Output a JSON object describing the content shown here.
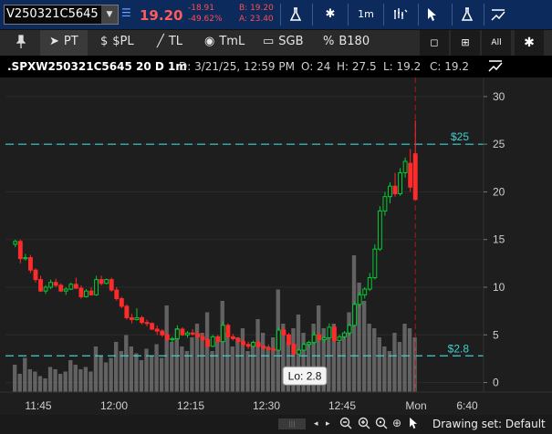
{
  "topbar": {
    "symbol": "V250321C5645",
    "last": "19.20",
    "change": "-18.91",
    "change_pct": "-49.62%",
    "bid": "B: 19.20",
    "ask": "A: 23.40",
    "timeframe_label": "1m",
    "icons": [
      "flask-icon",
      "gear-icon",
      "timeframe",
      "style-icon",
      "cursor-icon",
      "flask-icon",
      "chart-style-icon"
    ]
  },
  "toolbar": {
    "pin_icon": "pin-icon",
    "pt_label": "PT",
    "spl_label": "$PL",
    "tl_label": "TL",
    "tml_label": "TmL",
    "sgb_label": "SGB",
    "b180_label": "B180",
    "right_icons": [
      "square-icon",
      "grid-icon",
      "all-label",
      "gear-icon"
    ],
    "all_text": "All"
  },
  "header": {
    "title": ".SPXW250321C5645 20 D 1m",
    "date": "D: 3/21/25, 12:59 PM",
    "open": "O: 24",
    "high": "H: 27.5",
    "low": "L: 19.2",
    "close": "C: 19.2"
  },
  "chart_data": {
    "type": "candlestick",
    "y_ticks": [
      "30",
      "25",
      "20",
      "15",
      "10",
      "5",
      "0"
    ],
    "x_ticks": [
      "11:45",
      "12:00",
      "12:15",
      "12:30",
      "12:45",
      "Mon",
      "6:40"
    ],
    "ylim": [
      -1,
      32
    ],
    "level_lines": [
      {
        "label": "$25",
        "value": 25,
        "color": "#3fd0d0"
      },
      {
        "label": "$2.8",
        "value": 2.8,
        "color": "#3fd0d0"
      }
    ],
    "low_marker": "Lo: 2.8",
    "colors": {
      "up": "#00cc33",
      "down": "#ff2a2a",
      "volume": "#7a7a7a"
    },
    "candles": [
      [
        14.5,
        15,
        14.2,
        14.8
      ],
      [
        14.8,
        15,
        12.5,
        13
      ],
      [
        13,
        13.5,
        12.8,
        13.1
      ],
      [
        13.1,
        13.4,
        11.5,
        11.8
      ],
      [
        11.8,
        12,
        10.5,
        10.8
      ],
      [
        10.8,
        11.2,
        9.5,
        9.6
      ],
      [
        9.6,
        10.2,
        9.3,
        10
      ],
      [
        10,
        10.8,
        9.8,
        10.5
      ],
      [
        10.5,
        10.9,
        10,
        10.2
      ],
      [
        10.2,
        10.4,
        9.5,
        9.6
      ],
      [
        9.6,
        10,
        9.2,
        9.8
      ],
      [
        9.8,
        10.5,
        9.7,
        10.3
      ],
      [
        10.3,
        11,
        9.8,
        9.9
      ],
      [
        9.9,
        10.2,
        8.8,
        9
      ],
      [
        9,
        9.8,
        8.9,
        9.6
      ],
      [
        9.6,
        10,
        9.1,
        9.2
      ],
      [
        9.2,
        11.2,
        9.1,
        10.8
      ],
      [
        10.8,
        11.2,
        10.2,
        10.4
      ],
      [
        10.4,
        10.9,
        10.3,
        10.8
      ],
      [
        10.8,
        11,
        9.5,
        9.7
      ],
      [
        9.7,
        10,
        8.6,
        8.8
      ],
      [
        8.8,
        9,
        7.8,
        8
      ],
      [
        8,
        8.2,
        6.6,
        6.8
      ],
      [
        6.8,
        7.2,
        6.2,
        6.6
      ],
      [
        6.6,
        7.8,
        6.5,
        6.8
      ],
      [
        6.8,
        7,
        6.1,
        6.3
      ],
      [
        6.3,
        6.6,
        5.9,
        6.2
      ],
      [
        6.2,
        6.3,
        5.5,
        5.6
      ],
      [
        5.6,
        6,
        5,
        5.4
      ],
      [
        5.4,
        5.6,
        4.8,
        5
      ],
      [
        5,
        5.2,
        4.3,
        4.5
      ],
      [
        4.5,
        4.8,
        4.2,
        4.6
      ],
      [
        4.6,
        6,
        4.5,
        5.6
      ],
      [
        5.6,
        5.8,
        4.9,
        5
      ],
      [
        5,
        5.4,
        4.7,
        5.2
      ],
      [
        5.2,
        5.6,
        4.9,
        5.1
      ],
      [
        5.1,
        5.4,
        4.6,
        4.8
      ],
      [
        4.8,
        5.2,
        4.2,
        4.5
      ],
      [
        4.5,
        4.8,
        3.6,
        3.8
      ],
      [
        3.8,
        5,
        3.7,
        4.8
      ],
      [
        4.8,
        5,
        4.1,
        4.3
      ],
      [
        4.3,
        6.4,
        4.2,
        6
      ],
      [
        6,
        6.2,
        4.6,
        4.8
      ],
      [
        4.8,
        5.1,
        4.4,
        4.6
      ],
      [
        4.6,
        4.8,
        4.1,
        4.3
      ],
      [
        4.3,
        4.6,
        3.8,
        4
      ],
      [
        4,
        4.3,
        3.5,
        3.8
      ],
      [
        3.8,
        4.4,
        3.7,
        4.2
      ],
      [
        4.2,
        4.5,
        3.6,
        3.8
      ],
      [
        3.8,
        4,
        3.4,
        3.6
      ],
      [
        3.6,
        4,
        3.3,
        3.5
      ],
      [
        3.5,
        3.8,
        3.2,
        3.4
      ],
      [
        3.4,
        5.8,
        3.3,
        5.5
      ],
      [
        5.5,
        5.8,
        4.8,
        5
      ],
      [
        5,
        5.2,
        3.8,
        4
      ],
      [
        4,
        4.2,
        2.8,
        3
      ],
      [
        3,
        3.6,
        2.9,
        3.4
      ],
      [
        3.4,
        4.2,
        3.3,
        4
      ],
      [
        4,
        4.4,
        3.7,
        4.2
      ],
      [
        4.2,
        5.4,
        4,
        5
      ],
      [
        5,
        5.2,
        4.3,
        4.5
      ],
      [
        4.5,
        4.9,
        4.2,
        4.7
      ],
      [
        4.7,
        6.2,
        4.6,
        5.8
      ],
      [
        5.8,
        6,
        4.2,
        4.4
      ],
      [
        4.4,
        5,
        4.2,
        4.8
      ],
      [
        4.8,
        5.4,
        4.6,
        5.2
      ],
      [
        5.2,
        6.2,
        4.9,
        6
      ],
      [
        6,
        8.5,
        5.9,
        8.2
      ],
      [
        8.2,
        9.5,
        7.9,
        9.2
      ],
      [
        9.2,
        10,
        8.8,
        9.8
      ],
      [
        9.8,
        11.5,
        9.6,
        11
      ],
      [
        11,
        14.5,
        10.8,
        14
      ],
      [
        14,
        18.5,
        13.8,
        18
      ],
      [
        18,
        20,
        17.5,
        19.5
      ],
      [
        19.5,
        21,
        18.8,
        20.6
      ],
      [
        20.6,
        22,
        19.5,
        19.8
      ],
      [
        19.8,
        22.5,
        19.6,
        22
      ],
      [
        22,
        23.6,
        21.5,
        23.2
      ],
      [
        23,
        24.5,
        20,
        20.5
      ],
      [
        24,
        27.5,
        19.2,
        19.2
      ]
    ],
    "volumes": [
      12,
      8,
      15,
      10,
      9,
      7,
      6,
      11,
      10,
      8,
      9,
      14,
      12,
      10,
      11,
      9,
      20,
      16,
      13,
      15,
      22,
      18,
      25,
      20,
      17,
      14,
      19,
      16,
      21,
      15,
      38,
      22,
      28,
      20,
      18,
      24,
      30,
      26,
      35,
      18,
      22,
      40,
      26,
      20,
      24,
      28,
      18,
      22,
      32,
      26,
      20,
      24,
      45,
      30,
      22,
      28,
      34,
      26,
      22,
      30,
      38,
      28,
      24,
      30,
      22,
      26,
      35,
      60,
      48,
      40,
      30,
      28,
      24,
      20,
      18,
      26,
      22,
      30,
      28,
      24
    ]
  },
  "bottom": {
    "drawing_set": "Drawing set: Default",
    "icons": [
      "scroll-left-icon",
      "zoom-out-icon",
      "zoom-in-icon",
      "zoom-fit-icon",
      "crosshair-icon",
      "cursor-icon"
    ]
  }
}
